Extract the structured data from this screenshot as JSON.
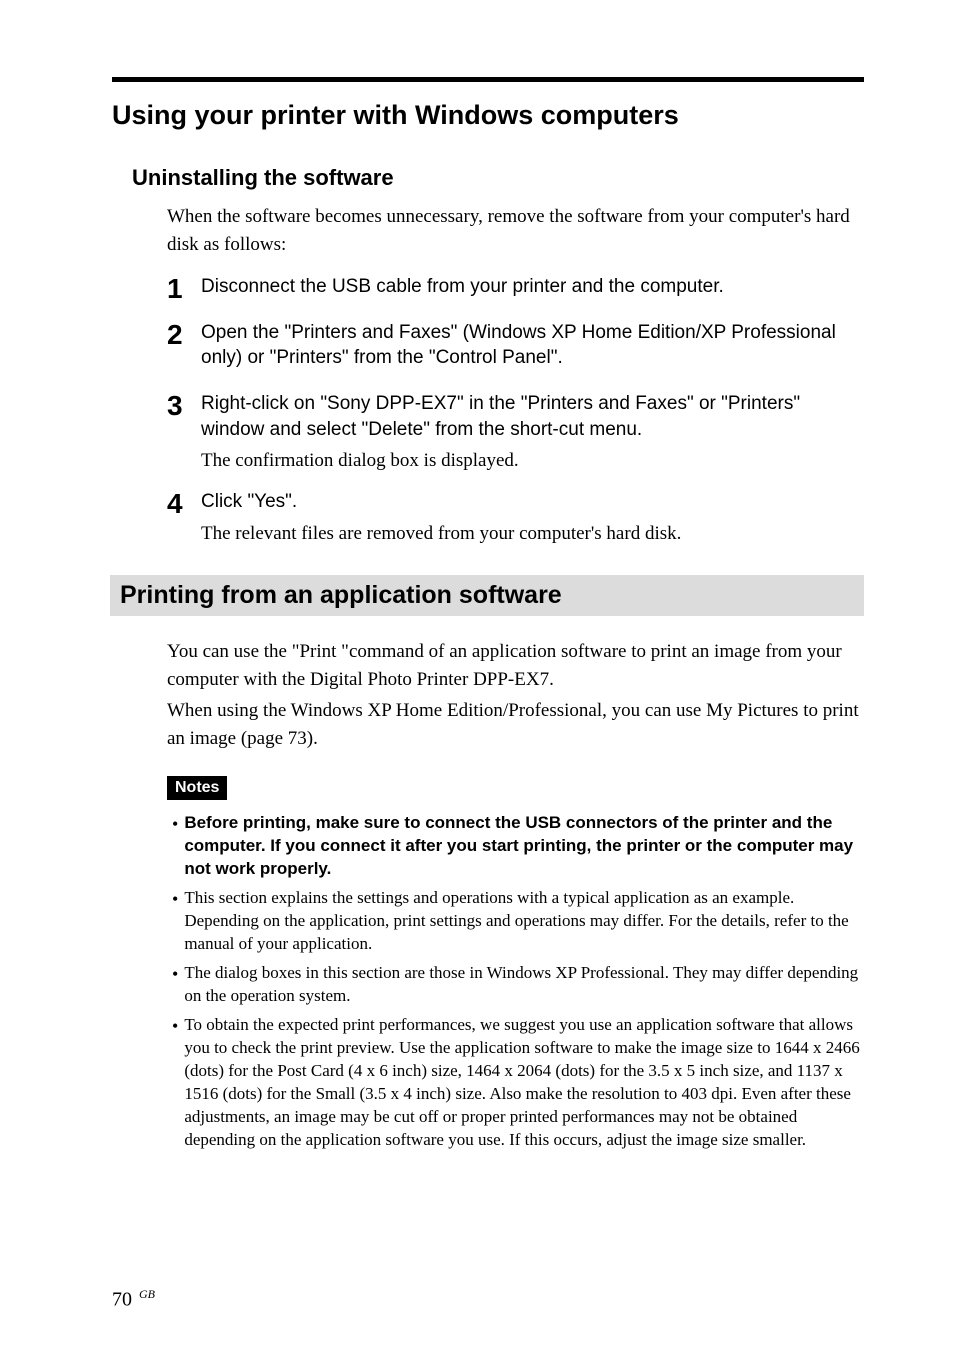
{
  "top_heading": "Using your printer with Windows computers",
  "uninstall": {
    "heading": "Uninstalling the software",
    "intro": "When the software becomes unnecessary, remove the software from your computer's hard disk as follows:",
    "steps": [
      {
        "num": "1",
        "title": "Disconnect the USB cable from your printer and the computer.",
        "desc": ""
      },
      {
        "num": "2",
        "title": "Open the \"Printers and Faxes\" (Windows XP Home Edition/XP Professional only) or \"Printers\" from the \"Control Panel\".",
        "desc": ""
      },
      {
        "num": "3",
        "title": "Right-click on  \"Sony DPP-EX7\" in the \"Printers and Faxes\" or \"Printers\" window and select \"Delete\" from the short-cut menu.",
        "desc": "The confirmation dialog box is displayed."
      },
      {
        "num": "4",
        "title": "Click \"Yes\".",
        "desc": "The relevant files are removed from your computer's hard disk."
      }
    ]
  },
  "printing": {
    "heading": "Printing from an application software",
    "para1": "You can use the \"Print \"command of an application software to print an image from your computer with the Digital Photo Printer DPP-EX7.",
    "para2": "When using the Windows XP Home Edition/Professional, you can use My Pictures to print an image (page 73).",
    "notes_label": "Notes",
    "notes": [
      {
        "bold": true,
        "text": "Before printing, make sure to connect the USB connectors of the printer and the computer.  If you connect it after you start printing, the printer or the computer may not work properly."
      },
      {
        "bold": false,
        "text": "This section explains the settings and operations with a typical application as an example.  Depending on the application, print settings and operations may differ.  For the details, refer to the manual of your application."
      },
      {
        "bold": false,
        "text": "The dialog boxes in this section are those in Windows XP Professional.  They may differ depending on the operation system."
      },
      {
        "bold": false,
        "text": "To obtain the expected print performances, we suggest you use an application software that allows you to check the print preview.  Use the application software to make the image size to 1644 x 2466 (dots) for the Post Card (4 x 6 inch) size, 1464 x 2064 (dots) for the 3.5 x 5 inch size, and 1137 x 1516 (dots) for the Small (3.5 x 4 inch) size.  Also make the resolution to 403 dpi.  Even after these adjustments, an image may be cut off or proper printed performances may not be obtained depending on the application software you use.  If this occurs, adjust the image size smaller."
      }
    ]
  },
  "page_number": "70",
  "page_suffix": "GB"
}
